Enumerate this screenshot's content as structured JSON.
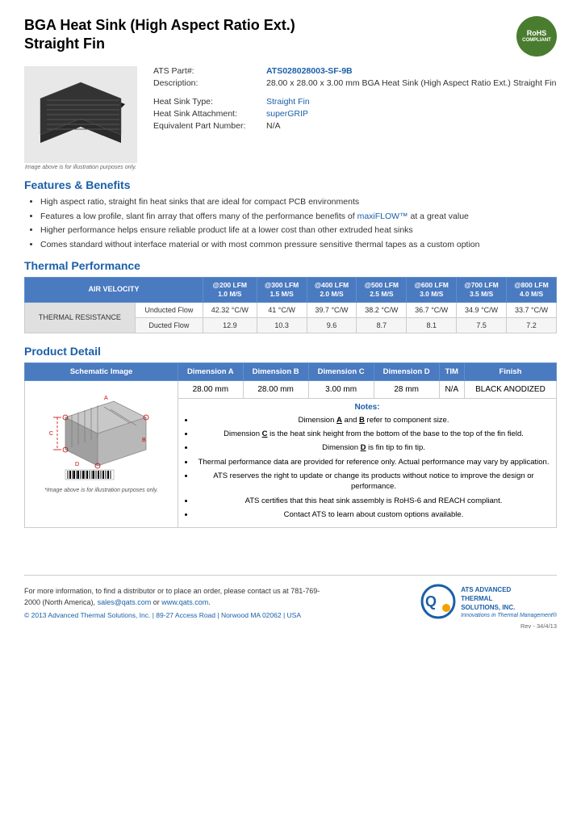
{
  "header": {
    "title_line1": "BGA Heat Sink (High Aspect Ratio Ext.)",
    "title_line2": "Straight Fin",
    "rohs_line1": "RoHS",
    "rohs_line2": "COMPLIANT"
  },
  "product_info": {
    "part_label": "ATS Part#:",
    "part_number": "ATS028028003-SF-9B",
    "description_label": "Description:",
    "description_value": "28.00 x 28.00 x 3.00 mm  BGA Heat Sink (High Aspect Ratio Ext.) Straight Fin",
    "heat_sink_type_label": "Heat Sink Type:",
    "heat_sink_type_value": "Straight Fin",
    "attachment_label": "Heat Sink Attachment:",
    "attachment_value": "superGRIP",
    "equiv_part_label": "Equivalent Part Number:",
    "equiv_part_value": "N/A",
    "image_note": "Image above is for illustration purposes only."
  },
  "features": {
    "title": "Features & Benefits",
    "items": [
      "High aspect ratio, straight fin heat sinks that are ideal for compact PCB environments",
      "Features a low profile, slant fin array that offers many of the performance benefits of maxiFLOW™ at a great value",
      "Higher performance helps ensure reliable product life at a lower cost than other extruded heat sinks",
      "Comes standard without interface material or with most common pressure sensitive thermal tapes as a custom option"
    ],
    "highlight_text": "maxiFLOW™"
  },
  "thermal_performance": {
    "title": "Thermal Performance",
    "table": {
      "header_col1": "AIR VELOCITY",
      "columns": [
        {
          "label": "@200 LFM\n1.0 M/S"
        },
        {
          "label": "@300 LFM\n1.5 M/S"
        },
        {
          "label": "@400 LFM\n2.0 M/S"
        },
        {
          "label": "@500 LFM\n2.5 M/S"
        },
        {
          "label": "@600 LFM\n3.0 M/S"
        },
        {
          "label": "@700 LFM\n3.5 M/S"
        },
        {
          "label": "@800 LFM\n4.0 M/S"
        }
      ],
      "row_label": "THERMAL RESISTANCE",
      "rows": [
        {
          "label": "Unducted Flow",
          "values": [
            "42.32 °C/W",
            "41 °C/W",
            "39.7 °C/W",
            "38.2 °C/W",
            "36.7 °C/W",
            "34.9 °C/W",
            "33.7 °C/W"
          ]
        },
        {
          "label": "Ducted Flow",
          "values": [
            "12.9",
            "10.3",
            "9.6",
            "8.7",
            "8.1",
            "7.5",
            "7.2"
          ]
        }
      ]
    }
  },
  "product_detail": {
    "title": "Product Detail",
    "table_headers": [
      "Schematic Image",
      "Dimension A",
      "Dimension B",
      "Dimension C",
      "Dimension D",
      "TIM",
      "Finish"
    ],
    "dimensions": {
      "dim_a": "28.00 mm",
      "dim_b": "28.00 mm",
      "dim_c": "3.00 mm",
      "dim_d": "28 mm",
      "tim": "N/A",
      "finish": "BLACK ANODIZED"
    },
    "notes_title": "Notes:",
    "notes": [
      "Dimension A and B refer to component size.",
      "Dimension C is the heat sink height from the bottom of the base to the top of the fin field.",
      "Dimension D is fin tip to fin tip.",
      "Thermal performance data are provided for reference only. Actual performance may vary by application.",
      "ATS reserves the right to update or change its products without notice to improve the design or performance.",
      "ATS certifies that this heat sink assembly is RoHS-6 and REACH compliant.",
      "Contact ATS to learn about custom options available."
    ],
    "schematic_note": "*Image above is for illustration purposes only."
  },
  "footer": {
    "contact_text": "For more information, to find a distributor or to place an order, please contact us at",
    "phone": "781-769-2000 (North America),",
    "email": "sales@qats.com",
    "email_connector": "or",
    "website": "www.qats.com",
    "copyright": "© 2013 Advanced Thermal Solutions, Inc. | 89-27 Access Road | Norwood MA  02062 | USA",
    "company_name": "ADVANCED\nTHERMAL\nSOLUTIONS, INC.",
    "tagline": "Innovations in Thermal Management®",
    "rev": "Rev - 34/4/13"
  }
}
